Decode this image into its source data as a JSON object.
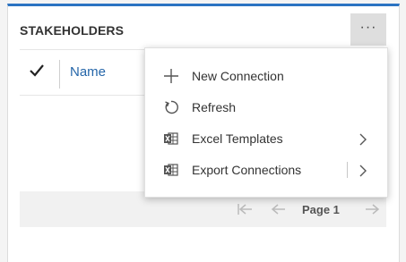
{
  "panel": {
    "title": "STAKEHOLDERS",
    "more_label": "···",
    "accent_color": "#2b73c2"
  },
  "grid": {
    "check_icon": "checkmark-icon",
    "columns": [
      {
        "label": "Name"
      }
    ],
    "link_color": "#2566a9"
  },
  "pager": {
    "first_icon": "first-page-icon",
    "prev_icon": "previous-page-icon",
    "page_label": "Page 1",
    "next_icon": "next-page-icon"
  },
  "menu": {
    "items": [
      {
        "label": "New Connection",
        "icon": "plus-icon",
        "submenu": false
      },
      {
        "label": "Refresh",
        "icon": "refresh-icon",
        "submenu": false
      },
      {
        "label": "Excel Templates",
        "icon": "excel-icon",
        "submenu": true
      },
      {
        "label": "Export Connections",
        "icon": "excel-icon",
        "submenu": true,
        "split": true
      }
    ]
  }
}
